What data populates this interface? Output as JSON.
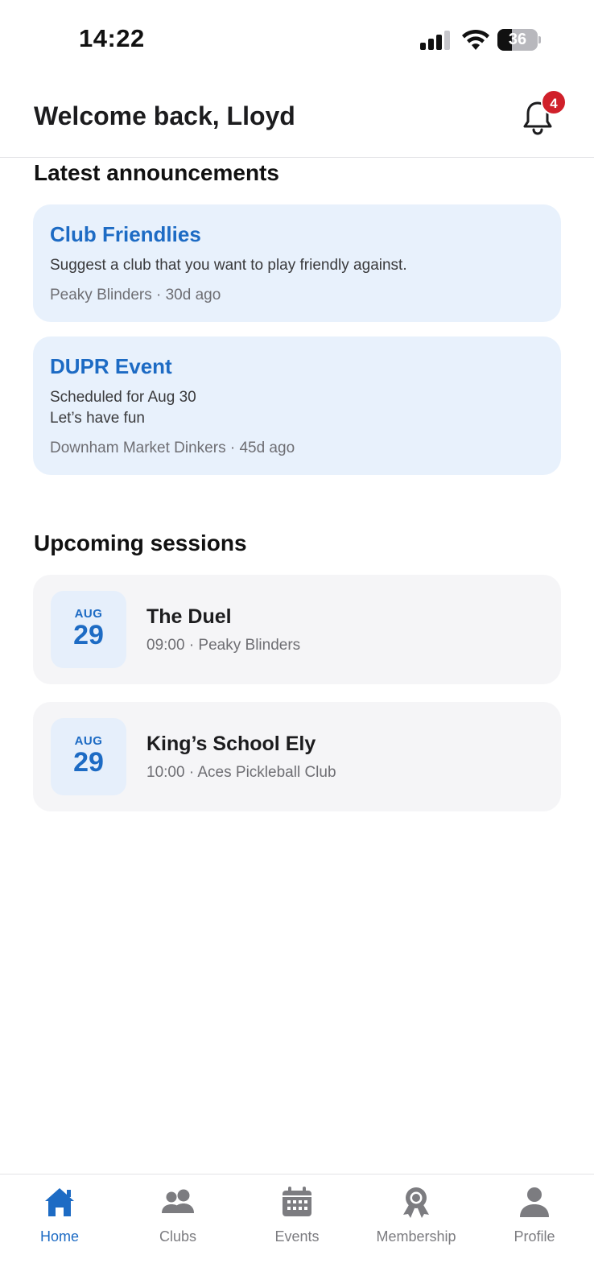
{
  "status_bar": {
    "time": "14:22",
    "battery": "36",
    "battery_level": 0.36
  },
  "header": {
    "title": "Welcome back, Lloyd",
    "notification_count": "4"
  },
  "announcements": {
    "heading": "Latest announcements",
    "items": [
      {
        "title": "Club Friendlies",
        "body": "Suggest a club that you want to play friendly against.",
        "meta": "Peaky Blinders · 30d ago"
      },
      {
        "title": "DUPR Event",
        "body_line1": "Scheduled for Aug 30",
        "body_line2": "Let’s have fun",
        "meta": "Downham Market Dinkers · 45d ago"
      }
    ]
  },
  "sessions": {
    "heading": "Upcoming sessions",
    "items": [
      {
        "month": "AUG",
        "day": "29",
        "name": "The Duel",
        "meta": "09:00 · Peaky Blinders"
      },
      {
        "month": "AUG",
        "day": "29",
        "name": "King’s School Ely",
        "meta": "10:00 · Aces Pickleball Club"
      }
    ]
  },
  "tab_bar": {
    "active": "Home",
    "tabs": [
      {
        "label": "Home",
        "icon": "home-icon"
      },
      {
        "label": "Clubs",
        "icon": "clubs-icon"
      },
      {
        "label": "Events",
        "icon": "calendar-icon"
      },
      {
        "label": "Membership",
        "icon": "award-icon"
      },
      {
        "label": "Profile",
        "icon": "profile-icon"
      }
    ]
  },
  "colors": {
    "accent": "#1d6bc4",
    "badge": "#d0202a",
    "announcement_bg": "#e8f1fc",
    "session_bg": "#f5f5f7",
    "inactive": "#7c7c80"
  }
}
